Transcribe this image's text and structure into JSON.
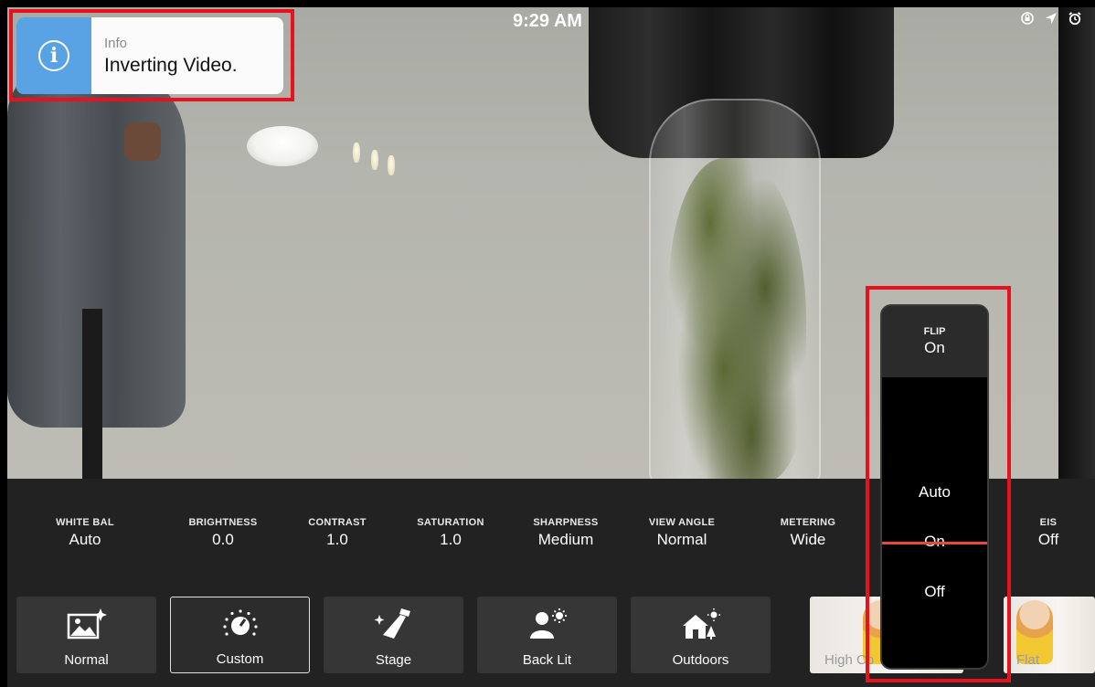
{
  "status_bar": {
    "time": "9:29 AM",
    "icons": [
      "rotation-lock-icon",
      "location-arrow-icon",
      "alarm-icon"
    ]
  },
  "toast": {
    "title": "Info",
    "message": "Inverting Video.",
    "icon": "info-icon",
    "accent_color": "#59a3e4"
  },
  "settings": [
    {
      "label": "WHITE BAL",
      "value": "Auto"
    },
    {
      "label": "BRIGHTNESS",
      "value": "0.0"
    },
    {
      "label": "CONTRAST",
      "value": "1.0"
    },
    {
      "label": "SATURATION",
      "value": "1.0"
    },
    {
      "label": "SHARPNESS",
      "value": "Medium"
    },
    {
      "label": "VIEW ANGLE",
      "value": "Normal"
    },
    {
      "label": "METERING",
      "value": "Wide"
    },
    {
      "label": "EIS",
      "value": "Off"
    }
  ],
  "presets": [
    {
      "label": "Normal",
      "icon": "image-sparkle-icon",
      "selected": false
    },
    {
      "label": "Custom",
      "icon": "custom-dial-icon",
      "selected": true
    },
    {
      "label": "Stage",
      "icon": "stage-spotlight-icon",
      "selected": false
    },
    {
      "label": "Back Lit",
      "icon": "backlit-person-icon",
      "selected": false
    },
    {
      "label": "Outdoors",
      "icon": "outdoors-house-icon",
      "selected": false
    }
  ],
  "style_thumbnails": [
    {
      "label": "High Co"
    },
    {
      "label": "Flat"
    }
  ],
  "flip_picker": {
    "title": "FLIP",
    "current": "On",
    "options": [
      "Auto",
      "On",
      "Off"
    ],
    "selected": "On",
    "indicator_color": "#e8483a"
  },
  "highlight_color": "#e8121e"
}
